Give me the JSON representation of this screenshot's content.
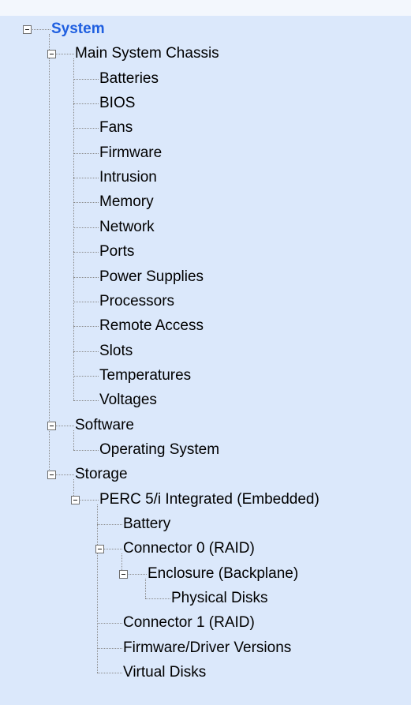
{
  "tree": {
    "nodes": [
      {
        "label": "System",
        "depth": 0,
        "expandable": true,
        "root": true
      },
      {
        "label": "Main System Chassis",
        "depth": 1,
        "expandable": true
      },
      {
        "label": "Batteries",
        "depth": 2,
        "expandable": false
      },
      {
        "label": "BIOS",
        "depth": 2,
        "expandable": false
      },
      {
        "label": "Fans",
        "depth": 2,
        "expandable": false
      },
      {
        "label": "Firmware",
        "depth": 2,
        "expandable": false
      },
      {
        "label": "Intrusion",
        "depth": 2,
        "expandable": false
      },
      {
        "label": "Memory",
        "depth": 2,
        "expandable": false
      },
      {
        "label": "Network",
        "depth": 2,
        "expandable": false
      },
      {
        "label": "Ports",
        "depth": 2,
        "expandable": false
      },
      {
        "label": "Power Supplies",
        "depth": 2,
        "expandable": false
      },
      {
        "label": "Processors",
        "depth": 2,
        "expandable": false
      },
      {
        "label": "Remote Access",
        "depth": 2,
        "expandable": false
      },
      {
        "label": "Slots",
        "depth": 2,
        "expandable": false
      },
      {
        "label": "Temperatures",
        "depth": 2,
        "expandable": false
      },
      {
        "label": "Voltages",
        "depth": 2,
        "expandable": false
      },
      {
        "label": "Software",
        "depth": 1,
        "expandable": true
      },
      {
        "label": "Operating System",
        "depth": 2,
        "expandable": false
      },
      {
        "label": "Storage",
        "depth": 1,
        "expandable": true
      },
      {
        "label": "PERC 5/i Integrated (Embedded)",
        "depth": 2,
        "expandable": true
      },
      {
        "label": "Battery",
        "depth": 3,
        "expandable": false
      },
      {
        "label": "Connector 0 (RAID)",
        "depth": 3,
        "expandable": true
      },
      {
        "label": "Enclosure (Backplane)",
        "depth": 4,
        "expandable": true
      },
      {
        "label": "Physical Disks",
        "depth": 5,
        "expandable": false
      },
      {
        "label": "Connector 1 (RAID)",
        "depth": 3,
        "expandable": false
      },
      {
        "label": "Firmware/Driver Versions",
        "depth": 3,
        "expandable": false
      },
      {
        "label": "Virtual Disks",
        "depth": 3,
        "expandable": false
      }
    ]
  },
  "colors": {
    "background": "#dbe8fb",
    "root_label": "#1f5fe0",
    "connector_line": "#8a8a8a"
  }
}
